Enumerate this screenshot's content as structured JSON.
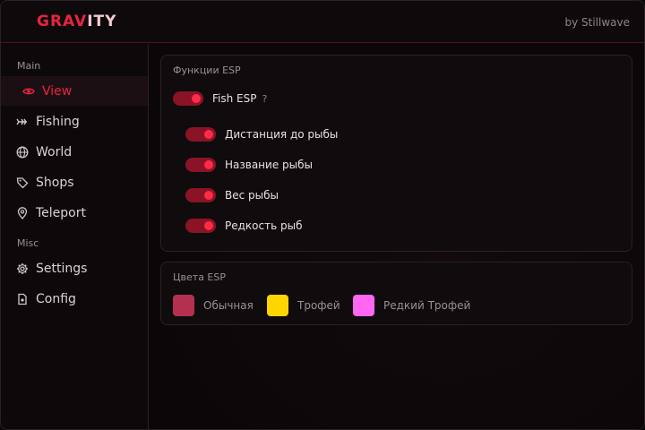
{
  "header": {
    "logo_part_a": "GRAV",
    "logo_part_b": "ITY",
    "byline": "by Stillwave"
  },
  "sidebar": {
    "sections": [
      {
        "label": "Main",
        "items": [
          {
            "label": "View",
            "icon": "eye-icon",
            "active": true
          },
          {
            "label": "Fishing",
            "icon": "fish-icon"
          },
          {
            "label": "World",
            "icon": "globe-icon"
          },
          {
            "label": "Shops",
            "icon": "tag-icon"
          },
          {
            "label": "Teleport",
            "icon": "map-pin-icon"
          }
        ]
      },
      {
        "label": "Misc",
        "items": [
          {
            "label": "Settings",
            "icon": "gear-icon"
          },
          {
            "label": "Config",
            "icon": "file-icon"
          }
        ]
      }
    ]
  },
  "esp_functions": {
    "title": "Функции ESP",
    "main_toggle": {
      "label": "Fish ESP",
      "help": "?",
      "on": true
    },
    "sub_toggles": [
      {
        "label": "Дистанция до рыбы",
        "on": true
      },
      {
        "label": "Название рыбы",
        "on": true
      },
      {
        "label": "Вес рыбы",
        "on": true
      },
      {
        "label": "Редкость рыб",
        "on": true
      }
    ]
  },
  "esp_colors": {
    "title": "Цвета ESP",
    "swatches": [
      {
        "label": "Обычная",
        "color": "#b3304f"
      },
      {
        "label": "Трофей",
        "color": "#ffd500"
      },
      {
        "label": "Редкий Трофей",
        "color": "#ff66f2"
      }
    ]
  },
  "colors": {
    "accent": "#e8243f",
    "toggle_track": "#8a1426"
  }
}
